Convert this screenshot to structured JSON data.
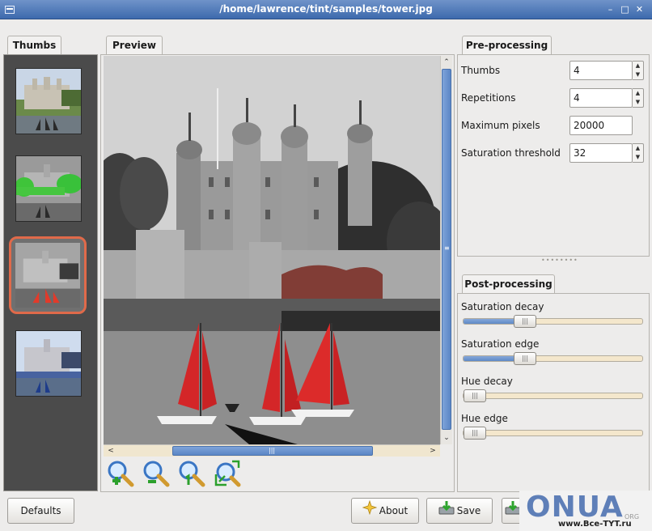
{
  "window": {
    "title": "/home/lawrence/tint/samples/tower.jpg"
  },
  "thumbs": {
    "tab_label": "Thumbs",
    "items": [
      {
        "name": "thumb-1"
      },
      {
        "name": "thumb-2"
      },
      {
        "name": "thumb-3",
        "selected": true
      },
      {
        "name": "thumb-4"
      }
    ]
  },
  "preview": {
    "tab_label": "Preview"
  },
  "zoom_buttons": [
    {
      "name": "zoom-in-icon"
    },
    {
      "name": "zoom-out-icon"
    },
    {
      "name": "zoom-100-icon"
    },
    {
      "name": "zoom-fit-icon"
    }
  ],
  "pre_processing": {
    "tab_label": "Pre-processing",
    "thumbs_label": "Thumbs",
    "thumbs_value": "4",
    "repetitions_label": "Repetitions",
    "repetitions_value": "4",
    "max_pixels_label": "Maximum pixels",
    "max_pixels_value": "20000",
    "saturation_threshold_label": "Saturation threshold",
    "saturation_threshold_value": "32"
  },
  "post_processing": {
    "tab_label": "Post-processing",
    "saturation_decay_label": "Saturation decay",
    "saturation_decay_level": 0.28,
    "saturation_edge_label": "Saturation edge",
    "saturation_edge_level": 0.28,
    "hue_decay_label": "Hue decay",
    "hue_decay_level": 0.0,
    "hue_edge_label": "Hue edge",
    "hue_edge_level": 0.0
  },
  "buttons": {
    "defaults": "Defaults",
    "about": "About",
    "save": "Save"
  },
  "watermark": {
    "big": "ONUA",
    "small": "www.Все-TYT.ru",
    "org": "ORG"
  }
}
